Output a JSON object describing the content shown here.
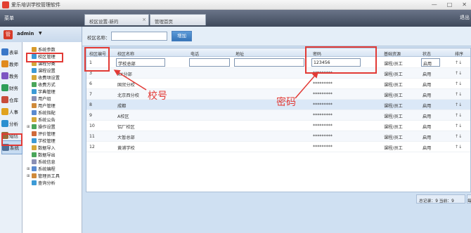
{
  "window": {
    "title": "爱乐培训学校管理软件",
    "controls": [
      "—",
      "□",
      "✕"
    ]
  },
  "menubar": {
    "label": "菜单",
    "tabs": [
      {
        "label": "校区设置-新的"
      },
      {
        "label": "管理首页"
      }
    ],
    "right_label": "退出"
  },
  "user": {
    "avatar_text": "管",
    "name": "admin",
    "caret": "▼"
  },
  "left_nav": [
    {
      "label": "表单",
      "color": "#3a77c8",
      "icon": "form-icon"
    },
    {
      "label": "教师",
      "color": "#e08a1e",
      "icon": "teacher-icon"
    },
    {
      "label": "教务",
      "color": "#7d56c2",
      "icon": "academic-icon"
    },
    {
      "label": "财务",
      "color": "#2f9e58",
      "icon": "finance-icon"
    },
    {
      "label": "仓库",
      "color": "#c84c3a",
      "icon": "warehouse-icon"
    },
    {
      "label": "人事",
      "color": "#e0a21e",
      "icon": "hr-icon"
    },
    {
      "label": "分析",
      "color": "#2b8fd0",
      "icon": "analysis-icon"
    },
    {
      "label": "短信",
      "color": "#9a6b3a",
      "icon": "sms-icon"
    },
    {
      "label": "系统",
      "color": "#4d6f96",
      "icon": "system-icon"
    }
  ],
  "tree": [
    {
      "label": "系统参数",
      "color": "#d89b2b",
      "expander": ""
    },
    {
      "label": "校区管理",
      "color": "#3c9ad6",
      "expander": ""
    },
    {
      "label": "课程分类",
      "color": "#d4a73a",
      "expander": ""
    },
    {
      "label": "课程设置",
      "color": "#3c9ad6",
      "expander": ""
    },
    {
      "label": "收费项设置",
      "color": "#d4a73a",
      "expander": ""
    },
    {
      "label": "收费方式",
      "color": "#4aa65a",
      "expander": ""
    },
    {
      "label": "字典管理",
      "color": "#3c9ad6",
      "expander": ""
    },
    {
      "label": "用户组",
      "color": "#8a8fb5",
      "expander": ""
    },
    {
      "label": "用户管理",
      "color": "#d08a3a",
      "expander": ""
    },
    {
      "label": "系统指配",
      "color": "#5a8ad0",
      "expander": ""
    },
    {
      "label": "系统公告",
      "color": "#d4a73a",
      "expander": ""
    },
    {
      "label": "操作设置",
      "color": "#4aa65a",
      "expander": "⊞"
    },
    {
      "label": "评价管理",
      "color": "#d06a3a",
      "expander": ""
    },
    {
      "label": "学校管理",
      "color": "#3c9ad6",
      "expander": ""
    },
    {
      "label": "数据导入",
      "color": "#d4a73a",
      "expander": ""
    },
    {
      "label": "数据导出",
      "color": "#4aa65a",
      "expander": ""
    },
    {
      "label": "系统信息",
      "color": "#8a8fb5",
      "expander": ""
    },
    {
      "label": "系统编程",
      "color": "#5a8ad0",
      "expander": "⊞"
    },
    {
      "label": "管理员工具",
      "color": "#d08a3a",
      "expander": "⊞"
    },
    {
      "label": "查询分析",
      "color": "#3c9ad6",
      "expander": ""
    }
  ],
  "search": {
    "label": "校区名称：",
    "placeholder": "",
    "button_label": "增加"
  },
  "grid": {
    "headers": [
      "校区编号",
      "校区名称",
      "电话",
      "地址",
      "密码",
      "基础资源",
      "状态",
      "排序"
    ],
    "rows": [
      {
        "id": "1",
        "name": "学校总部",
        "phone": "",
        "address": "",
        "password": "123456",
        "resource": "课程/员工",
        "status": "启用",
        "sort": "↑↓",
        "editing": true
      },
      {
        "id": "3",
        "name": "XX分部",
        "phone": "",
        "address": "",
        "password": "*********",
        "resource": "课程/员工",
        "status": "启用",
        "sort": "↑↓"
      },
      {
        "id": "6",
        "name": "国贸分校",
        "phone": "",
        "address": "",
        "password": "*********",
        "resource": "课程/员工",
        "status": "启用",
        "sort": "↑↓"
      },
      {
        "id": "7",
        "name": "北京西分校",
        "phone": "",
        "address": "",
        "password": "*********",
        "resource": "课程/员工",
        "status": "启用",
        "sort": "↑↓"
      },
      {
        "id": "8",
        "name": "成都",
        "phone": "",
        "address": "",
        "password": "*********",
        "resource": "课程/员工",
        "status": "启用",
        "sort": "↑↓",
        "selected": true
      },
      {
        "id": "9",
        "name": "A校区",
        "phone": "",
        "address": "",
        "password": "*********",
        "resource": "课程/员工",
        "status": "启用",
        "sort": "↑↓"
      },
      {
        "id": "10",
        "name": "铝厂校区",
        "phone": "",
        "address": "",
        "password": "*********",
        "resource": "课程/员工",
        "status": "启用",
        "sort": "↑↓"
      },
      {
        "id": "11",
        "name": "大暂总部",
        "phone": "",
        "address": "",
        "password": "*********",
        "resource": "课程/员工",
        "status": "启用",
        "sort": "↑↓"
      },
      {
        "id": "12",
        "name": "黄浦学校",
        "phone": "",
        "address": "",
        "password": "*********",
        "resource": "课程/员工",
        "status": "启用",
        "sort": "↑↓"
      }
    ],
    "status_options": [
      "启用"
    ]
  },
  "pager": {
    "summary": "总记录：9 当前：9",
    "extra": "每页"
  },
  "annotations": {
    "id_label": "校号",
    "password_label": "密码",
    "color": "#e23a35"
  }
}
